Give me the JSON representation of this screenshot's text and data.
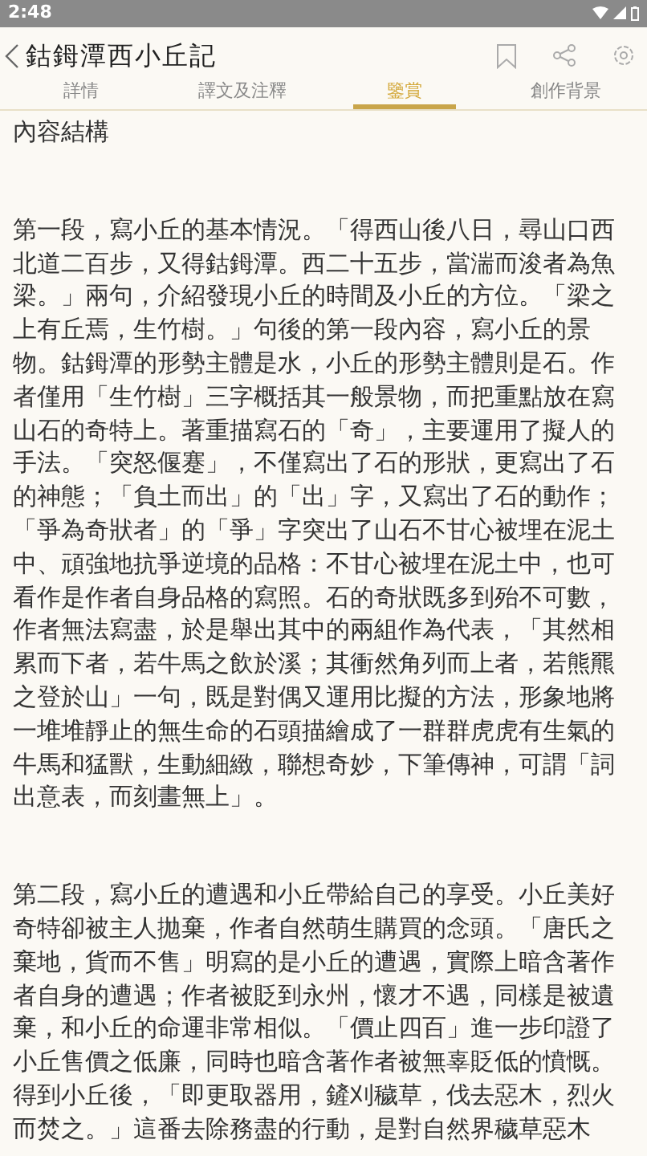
{
  "status_bar": {
    "time": "2:48"
  },
  "header": {
    "title": "鈷鉧潭西小丘記"
  },
  "tabs": [
    {
      "label": "詳情",
      "selected": false
    },
    {
      "label": "譯文及注釋",
      "selected": false
    },
    {
      "label": "鑒賞",
      "selected": true
    },
    {
      "label": "創作背景",
      "selected": false
    }
  ],
  "content": {
    "heading": "內容結構",
    "paragraphs": [
      "第一段，寫小丘的基本情況。「得西山後八日，尋山口西北道二百步，又得鈷鉧潭。西二十五步，當湍而浚者為魚梁。」兩句，介紹發現小丘的時間及小丘的方位。「梁之上有丘焉，生竹樹。」句後的第一段內容，寫小丘的景物。鈷鉧潭的形勢主體是水，小丘的形勢主體則是石。作者僅用「生竹樹」三字概括其一般景物，而把重點放在寫山石的奇特上。著重描寫石的「奇」，主要運用了擬人的手法。「突怒偃蹇」，不僅寫出了石的形狀，更寫出了石的神態；「負土而出」的「出」字，又寫出了石的動作；「爭為奇狀者」的「爭」字突出了山石不甘心被埋在泥土中、頑強地抗爭逆境的品格：不甘心被埋在泥土中，也可看作是作者自身品格的寫照。石的奇狀既多到殆不可數，作者無法寫盡，於是舉出其中的兩組作為代表，「其然相累而下者，若牛馬之飲於溪；其衝然角列而上者，若熊羆之登於山」一句，既是對偶又運用比擬的方法，形象地將一堆堆靜止的無生命的石頭描繪成了一群群虎虎有生氣的牛馬和猛獸，生動細緻，聯想奇妙，下筆傳神，可謂「詞出意表，而刻畫無上」。",
      "第二段，寫小丘的遭遇和小丘帶給自己的享受。小丘美好奇特卻被主人拋棄，作者自然萌生購買的念頭。「唐氏之棄地，貨而不售」明寫的是小丘的遭遇，實際上暗含著作者自身的遭遇；作者被貶到永州，懷才不遇，同樣是被遺棄，和小丘的命運非常相似。「價止四百」進一步印證了小丘售價之低廉，同時也暗含著作者被無辜貶低的憤慨。得到小丘後，「即更取器用，鏟刈穢草，伐去惡木，烈火而焚之。」這番去除務盡的行動，是對自然界穢草惡木"
    ]
  }
}
